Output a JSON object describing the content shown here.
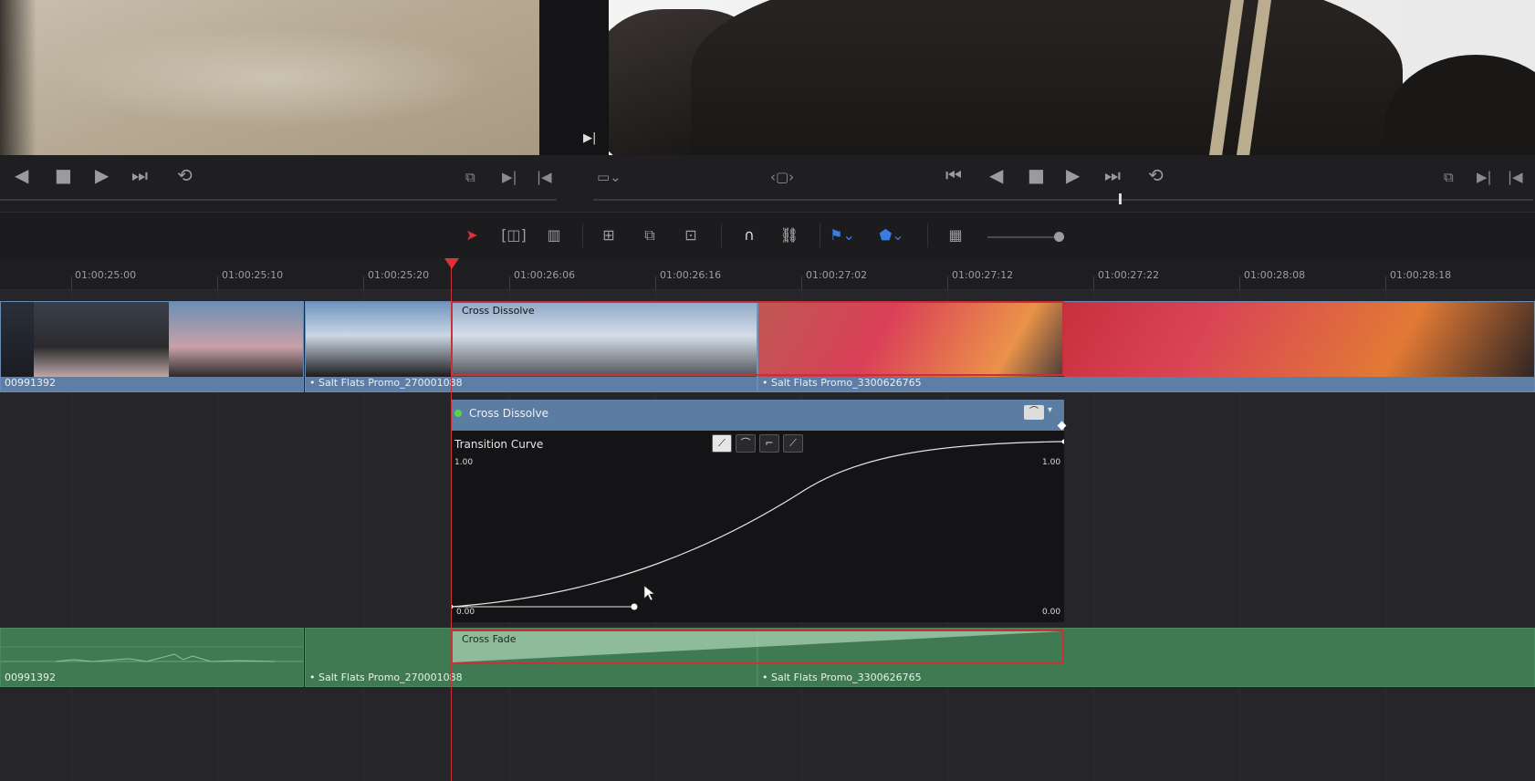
{
  "source_viewer": {
    "play_controls": [
      "◀",
      "■",
      "▶",
      "⏭",
      "⟲"
    ]
  },
  "record_viewer": {
    "play_controls": [
      "⏮",
      "◀",
      "■",
      "▶",
      "⏭",
      "⟲"
    ]
  },
  "toolbar": {
    "tools": [
      "selection-tool",
      "trim-tool",
      "blade-tool",
      "insert-clip",
      "overwrite-clip",
      "replace-clip",
      "snapping",
      "linked-selection",
      "flag",
      "marker",
      "timeline-view"
    ]
  },
  "ruler": {
    "timecodes": [
      "01:00:25:00",
      "01:00:25:10",
      "01:00:25:20",
      "01:00:26:06",
      "01:00:26:16",
      "01:00:27:02",
      "01:00:27:12",
      "01:00:27:22",
      "01:00:28:08",
      "01:00:28:18"
    ]
  },
  "video_track": {
    "clips": [
      {
        "name": "00991392"
      },
      {
        "name": "• Salt Flats Promo_270001088"
      },
      {
        "name": "• Salt Flats Promo_3300626765"
      }
    ],
    "transition_label": "Cross Dissolve"
  },
  "transition_inspector": {
    "title": "Cross Dissolve",
    "curve_title": "Transition Curve",
    "y_top_left": "1.00",
    "y_top_right": "1.00",
    "y_bottom_left": "0.00",
    "y_bottom_right": "0.00",
    "curve_buttons": [
      "ease-in-out",
      "ease-mid",
      "ease-in",
      "linear"
    ]
  },
  "audio_track": {
    "clips": [
      {
        "name": "00991392"
      },
      {
        "name": "• Salt Flats Promo_270001088"
      },
      {
        "name": "• Salt Flats Promo_3300626765"
      }
    ],
    "transition_label": "Cross Fade"
  },
  "colors": {
    "playhead": "#e0303c",
    "video_clip": "#5d7ea6",
    "audio_clip": "#3f7a52",
    "selection": "#c8303a"
  }
}
